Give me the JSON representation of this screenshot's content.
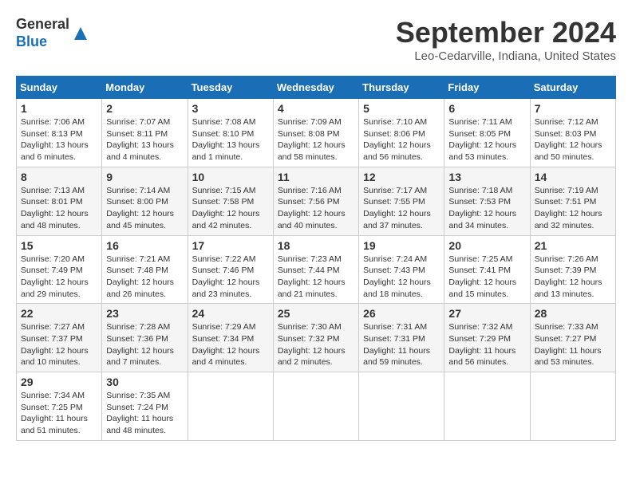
{
  "header": {
    "logo_general": "General",
    "logo_blue": "Blue",
    "title": "September 2024",
    "location": "Leo-Cedarville, Indiana, United States"
  },
  "days_of_week": [
    "Sunday",
    "Monday",
    "Tuesday",
    "Wednesday",
    "Thursday",
    "Friday",
    "Saturday"
  ],
  "weeks": [
    [
      {
        "day": "1",
        "sunrise": "7:06 AM",
        "sunset": "8:13 PM",
        "daylight": "13 hours and 6 minutes."
      },
      {
        "day": "2",
        "sunrise": "7:07 AM",
        "sunset": "8:11 PM",
        "daylight": "13 hours and 4 minutes."
      },
      {
        "day": "3",
        "sunrise": "7:08 AM",
        "sunset": "8:10 PM",
        "daylight": "13 hours and 1 minute."
      },
      {
        "day": "4",
        "sunrise": "7:09 AM",
        "sunset": "8:08 PM",
        "daylight": "12 hours and 58 minutes."
      },
      {
        "day": "5",
        "sunrise": "7:10 AM",
        "sunset": "8:06 PM",
        "daylight": "12 hours and 56 minutes."
      },
      {
        "day": "6",
        "sunrise": "7:11 AM",
        "sunset": "8:05 PM",
        "daylight": "12 hours and 53 minutes."
      },
      {
        "day": "7",
        "sunrise": "7:12 AM",
        "sunset": "8:03 PM",
        "daylight": "12 hours and 50 minutes."
      }
    ],
    [
      {
        "day": "8",
        "sunrise": "7:13 AM",
        "sunset": "8:01 PM",
        "daylight": "12 hours and 48 minutes."
      },
      {
        "day": "9",
        "sunrise": "7:14 AM",
        "sunset": "8:00 PM",
        "daylight": "12 hours and 45 minutes."
      },
      {
        "day": "10",
        "sunrise": "7:15 AM",
        "sunset": "7:58 PM",
        "daylight": "12 hours and 42 minutes."
      },
      {
        "day": "11",
        "sunrise": "7:16 AM",
        "sunset": "7:56 PM",
        "daylight": "12 hours and 40 minutes."
      },
      {
        "day": "12",
        "sunrise": "7:17 AM",
        "sunset": "7:55 PM",
        "daylight": "12 hours and 37 minutes."
      },
      {
        "day": "13",
        "sunrise": "7:18 AM",
        "sunset": "7:53 PM",
        "daylight": "12 hours and 34 minutes."
      },
      {
        "day": "14",
        "sunrise": "7:19 AM",
        "sunset": "7:51 PM",
        "daylight": "12 hours and 32 minutes."
      }
    ],
    [
      {
        "day": "15",
        "sunrise": "7:20 AM",
        "sunset": "7:49 PM",
        "daylight": "12 hours and 29 minutes."
      },
      {
        "day": "16",
        "sunrise": "7:21 AM",
        "sunset": "7:48 PM",
        "daylight": "12 hours and 26 minutes."
      },
      {
        "day": "17",
        "sunrise": "7:22 AM",
        "sunset": "7:46 PM",
        "daylight": "12 hours and 23 minutes."
      },
      {
        "day": "18",
        "sunrise": "7:23 AM",
        "sunset": "7:44 PM",
        "daylight": "12 hours and 21 minutes."
      },
      {
        "day": "19",
        "sunrise": "7:24 AM",
        "sunset": "7:43 PM",
        "daylight": "12 hours and 18 minutes."
      },
      {
        "day": "20",
        "sunrise": "7:25 AM",
        "sunset": "7:41 PM",
        "daylight": "12 hours and 15 minutes."
      },
      {
        "day": "21",
        "sunrise": "7:26 AM",
        "sunset": "7:39 PM",
        "daylight": "12 hours and 13 minutes."
      }
    ],
    [
      {
        "day": "22",
        "sunrise": "7:27 AM",
        "sunset": "7:37 PM",
        "daylight": "12 hours and 10 minutes."
      },
      {
        "day": "23",
        "sunrise": "7:28 AM",
        "sunset": "7:36 PM",
        "daylight": "12 hours and 7 minutes."
      },
      {
        "day": "24",
        "sunrise": "7:29 AM",
        "sunset": "7:34 PM",
        "daylight": "12 hours and 4 minutes."
      },
      {
        "day": "25",
        "sunrise": "7:30 AM",
        "sunset": "7:32 PM",
        "daylight": "12 hours and 2 minutes."
      },
      {
        "day": "26",
        "sunrise": "7:31 AM",
        "sunset": "7:31 PM",
        "daylight": "11 hours and 59 minutes."
      },
      {
        "day": "27",
        "sunrise": "7:32 AM",
        "sunset": "7:29 PM",
        "daylight": "11 hours and 56 minutes."
      },
      {
        "day": "28",
        "sunrise": "7:33 AM",
        "sunset": "7:27 PM",
        "daylight": "11 hours and 53 minutes."
      }
    ],
    [
      {
        "day": "29",
        "sunrise": "7:34 AM",
        "sunset": "7:25 PM",
        "daylight": "11 hours and 51 minutes."
      },
      {
        "day": "30",
        "sunrise": "7:35 AM",
        "sunset": "7:24 PM",
        "daylight": "11 hours and 48 minutes."
      },
      null,
      null,
      null,
      null,
      null
    ]
  ]
}
